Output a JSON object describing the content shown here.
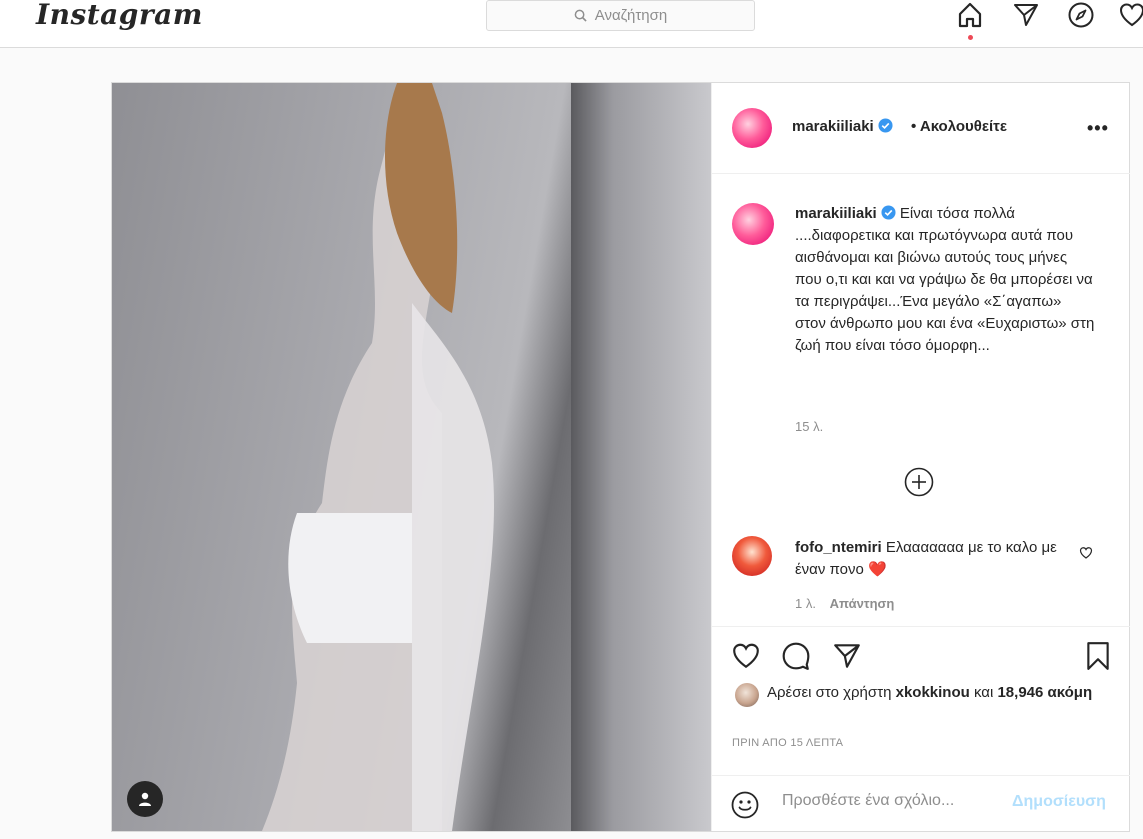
{
  "nav": {
    "logo": "Instagram",
    "search_placeholder": "Αναζήτηση"
  },
  "post": {
    "author": "marakiiliaki",
    "follow_status": "• Ακολουθείτε",
    "caption": "Είναι τόσα πολλά ....διαφορετικα και πρωτόγνωρα αυτά που αισθάνομαι και βιώνω αυτούς τους μήνες που ο,τι και και να γράψω δε θα μπορέσει να τα περιγράψει...Ένα μεγάλο «Σ΄αγαπω» στον άνθρωπο μου και ένα «Ευχαριστω» στη ζωή που είναι τόσο όμορφη...",
    "caption_age": "15 λ."
  },
  "comments": [
    {
      "user": "fofo_ntemiri",
      "text": "Ελααααααα με το καλο με έναν πονο",
      "emoji": "❤️",
      "age": "1 λ.",
      "reply_label": "Απάντηση"
    }
  ],
  "likes": {
    "prefix": "Αρέσει στο χρήστη",
    "user": "xkokkinou",
    "joiner": "και",
    "count": "18,946 ακόμη"
  },
  "timestamp": "ΠΡΙΝ ΑΠΟ 15 ΛΕΠΤΑ",
  "add_comment": {
    "placeholder": "Προσθέστε ένα σχόλιο...",
    "post_label": "Δημοσίευση"
  },
  "colors": {
    "accent": "#0095f6",
    "verified": "#3897f0",
    "notification_dot": "#ed4956",
    "border": "#dbdbdb"
  }
}
